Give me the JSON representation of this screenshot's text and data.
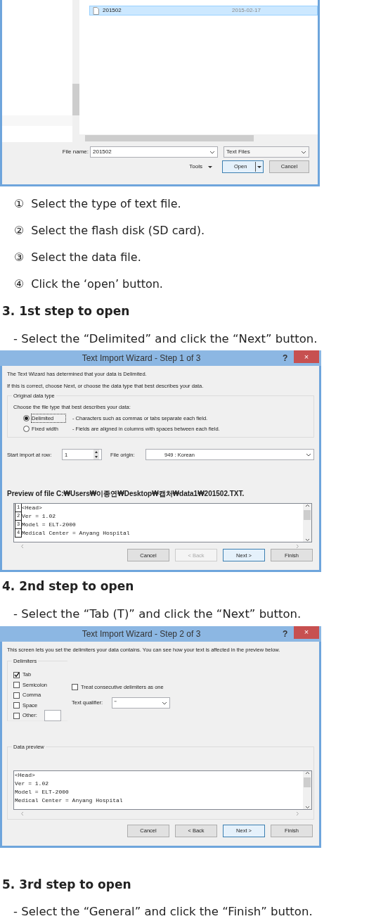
{
  "file_dialog": {
    "files": [
      {
        "name": "201502",
        "date": "2015-02-17",
        "selected": true
      }
    ],
    "file_name_label": "File name:",
    "file_name": "201502",
    "file_type": "Text Files",
    "tools": "Tools",
    "open": "Open",
    "cancel": "Cancel"
  },
  "steps": [
    {
      "marker": "①",
      "text": "Select the type of text file."
    },
    {
      "marker": "②",
      "text": "Select the flash disk (SD card)."
    },
    {
      "marker": "③",
      "text": "Select the data file."
    },
    {
      "marker": "④",
      "text": "Click the ‘open’ button."
    }
  ],
  "sections": [
    {
      "heading": "3. 1st step to open",
      "instruction": "- Select the “Delimited” and click the “Next” button.",
      "wizard": {
        "kind": "step1",
        "title": "Text Import Wizard - Step 1 of 3",
        "help": "?",
        "close": "×",
        "intro": [
          "The Text Wizard has determined that your data is Delimited.",
          "If this is correct, choose Next, or choose the data type that best describes your data."
        ],
        "group_label": "Original data type",
        "prompt": "Choose the file type that best describes your data:",
        "options": [
          {
            "label": "Delimited",
            "description": "- Characters such as commas or tabs separate each field.",
            "selected": true
          },
          {
            "label": "Fixed width",
            "description": "- Fields are aligned in columns with spaces between each field.",
            "selected": false
          }
        ],
        "start_row_label": "Start import at row:",
        "start_row": "1",
        "origin_label": "File origin:",
        "origin": "949 : Korean",
        "preview_label": "Preview of file C:₩Users₩이종연₩Desktop₩캡처₩data1₩201502.TXT.",
        "preview_lines": [
          {
            "number": "1",
            "text": "<Head>"
          },
          {
            "number": "2",
            "text": "Ver = 1.02"
          },
          {
            "number": "3",
            "text": "Model = ELT-2000"
          },
          {
            "number": "4",
            "text": "Medical Center = Anyang Hospital"
          }
        ],
        "buttons": [
          {
            "label": "Cancel",
            "disabled": false,
            "default": false
          },
          {
            "label": "< Back",
            "disabled": true,
            "default": false
          },
          {
            "label": "Next >",
            "disabled": false,
            "default": true
          },
          {
            "label": "Finish",
            "disabled": false,
            "default": false
          }
        ]
      }
    },
    {
      "heading": "4. 2nd step to open",
      "instruction": "- Select the “Tab (T)” and click the “Next” button.",
      "wizard": {
        "kind": "step2",
        "title": "Text Import Wizard - Step 2 of 3",
        "help": "?",
        "close": "×",
        "intro": [
          "This screen lets you set the delimiters your data contains.  You can see how your text is affected in the preview below."
        ],
        "group_label": "Delimiters",
        "delimiters": [
          {
            "label": "Tab",
            "checked": true
          },
          {
            "label": "Semicolon",
            "checked": false
          },
          {
            "label": "Comma",
            "checked": false
          },
          {
            "label": "Space",
            "checked": false
          },
          {
            "label": "Other:",
            "checked": false
          }
        ],
        "consecutive": {
          "label": "Treat consecutive delimiters as one",
          "checked": false
        },
        "qualifier_label": "Text qualifier:",
        "qualifier": "\"",
        "preview_label": "Data preview",
        "preview_lines": [
          {
            "text": "<Head>"
          },
          {
            "text": "Ver = 1.02"
          },
          {
            "text": "Model = ELT-2000"
          },
          {
            "text": "Medical Center = Anyang Hospital"
          }
        ],
        "buttons": [
          {
            "label": "Cancel",
            "disabled": false,
            "default": false
          },
          {
            "label": "< Back",
            "disabled": false,
            "default": false
          },
          {
            "label": "Next >",
            "disabled": false,
            "default": true
          },
          {
            "label": "Finish",
            "disabled": false,
            "default": false
          }
        ]
      }
    },
    {
      "heading": "5. 3rd step to open",
      "instruction": "- Select the “General” and click the “Finish” button."
    }
  ]
}
